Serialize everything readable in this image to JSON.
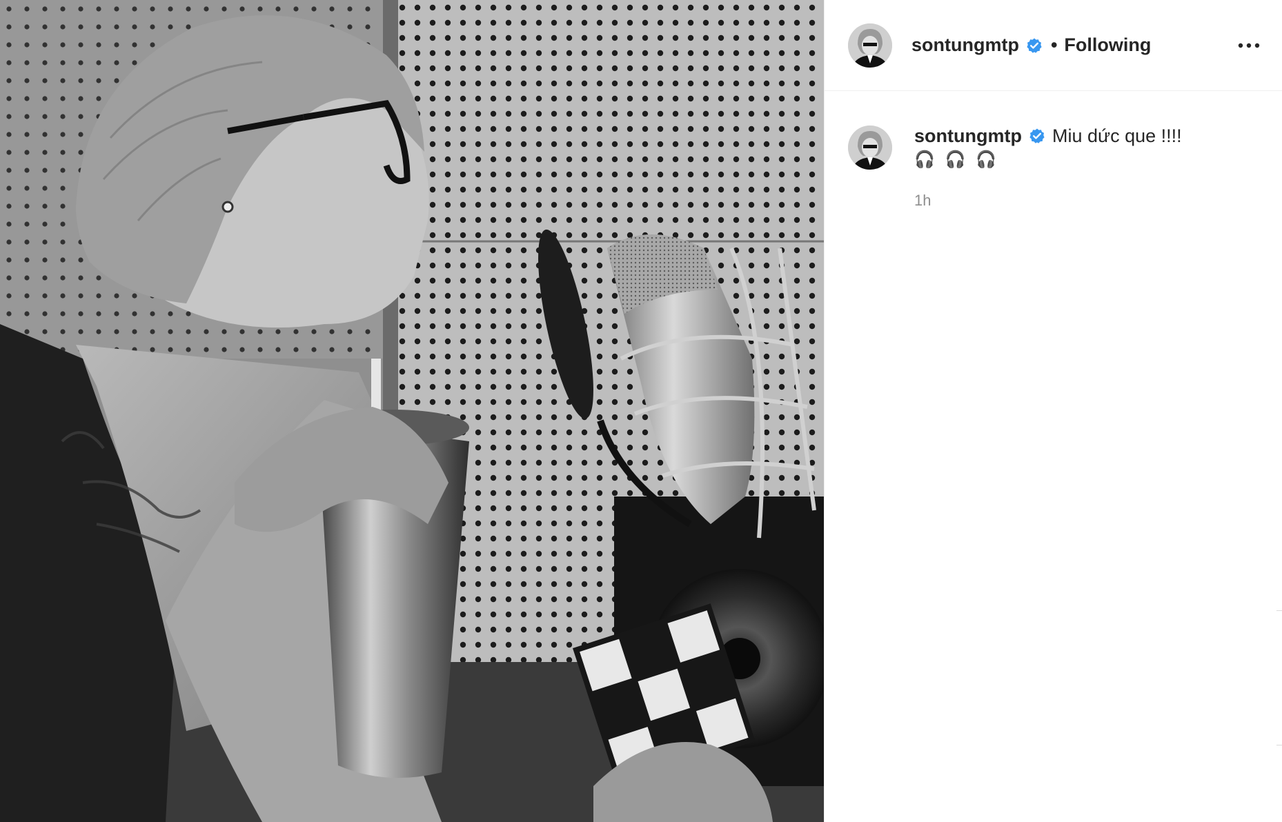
{
  "post": {
    "author": {
      "username": "sontungmtp",
      "verified": true,
      "follow_state": "Following",
      "separator": "•",
      "avatar_icon": "profile-avatar"
    },
    "more_options_icon": "more-horizontal-icon",
    "caption": {
      "username": "sontungmtp",
      "text": "Miu dức que !!!!",
      "emojis": "🎧 🎧 🎧",
      "timestamp": "1h"
    },
    "photo": {
      "description_icon": "post-photo",
      "tone": "black-and-white"
    }
  },
  "colors": {
    "verified_badge": "#3897f0",
    "text_primary": "#262626",
    "text_secondary": "#8e8e8e",
    "border": "#efefef"
  }
}
